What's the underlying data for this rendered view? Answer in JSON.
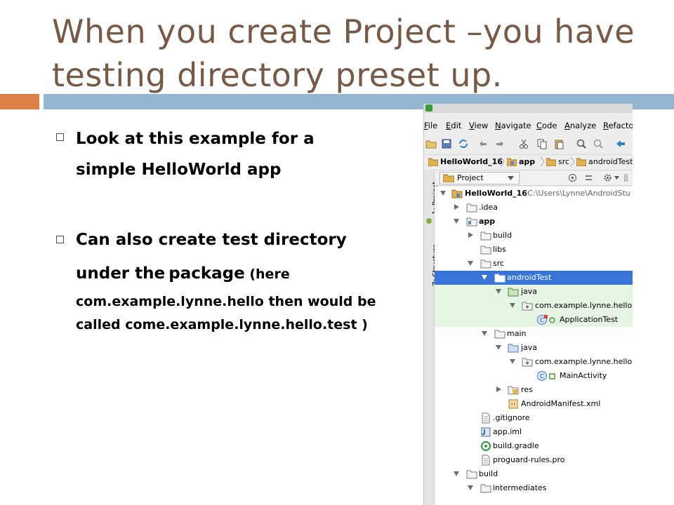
{
  "slide": {
    "title": "When you create Project –you have testing directory preset up.",
    "bullet1": "Look at this example for a simple HelloWorld app",
    "bullet2_line1": "Can also create test directory under the",
    "bullet2_package": "package",
    "bullet2_rest": " (here com.example.lynne.hello    then would be called come.example.lynne.hello.test )"
  },
  "colors": {
    "title": "#765a47",
    "accent_orange": "#dd8047",
    "accent_blue": "#94b6d2",
    "selection": "#3875d7"
  },
  "ide": {
    "menu": [
      "File",
      "Edit",
      "View",
      "Navigate",
      "Code",
      "Analyze",
      "Refactor"
    ],
    "toolbar_icons": [
      "open-folder-icon",
      "save-icon",
      "sync-icon",
      "undo-icon",
      "redo-icon",
      "cut-icon",
      "copy-icon",
      "paste-icon",
      "find-icon",
      "replace-icon",
      "back-icon"
    ],
    "breadcrumbs": [
      "HelloWorld_16",
      "app",
      "src",
      "androidTest"
    ],
    "side_tabs": [
      "1: Project",
      "Z: Structure"
    ],
    "view_selector": "Project",
    "tree": [
      {
        "label": "HelloWorld_16",
        "path": " (C:\\Users\\Lynne\\AndroidStu",
        "icon": "project-folder-icon",
        "expanded": true
      },
      {
        "label": ".idea",
        "icon": "folder-icon",
        "expanded": false
      },
      {
        "label": "app",
        "icon": "module-folder-icon",
        "expanded": true
      },
      {
        "label": "build",
        "icon": "folder-icon",
        "expanded": false
      },
      {
        "label": "libs",
        "icon": "folder-icon"
      },
      {
        "label": "src",
        "icon": "folder-icon",
        "expanded": true
      },
      {
        "label": "androidTest",
        "icon": "test-folder-icon",
        "expanded": true,
        "selected": true
      },
      {
        "label": "java",
        "icon": "test-source-folder-icon",
        "expanded": true
      },
      {
        "label": "com.example.lynne.hello",
        "icon": "package-icon",
        "expanded": true
      },
      {
        "label": "ApplicationTest",
        "icon": "test-class-icon"
      },
      {
        "label": "main",
        "icon": "folder-icon",
        "expanded": true
      },
      {
        "label": "java",
        "icon": "source-folder-icon",
        "expanded": true
      },
      {
        "label": "com.example.lynne.hello",
        "icon": "package-icon",
        "expanded": true
      },
      {
        "label": "MainActivity",
        "icon": "class-icon"
      },
      {
        "label": "res",
        "icon": "resource-folder-icon",
        "expanded": false
      },
      {
        "label": "AndroidManifest.xml",
        "icon": "manifest-file-icon"
      },
      {
        "label": ".gitignore",
        "icon": "text-file-icon"
      },
      {
        "label": "app.iml",
        "icon": "iml-file-icon"
      },
      {
        "label": "build.gradle",
        "icon": "gradle-file-icon"
      },
      {
        "label": "proguard-rules.pro",
        "icon": "text-file-icon"
      },
      {
        "label": "build",
        "icon": "folder-icon",
        "expanded": true
      },
      {
        "label": "intermediates",
        "icon": "folder-icon",
        "expanded": true
      }
    ]
  }
}
